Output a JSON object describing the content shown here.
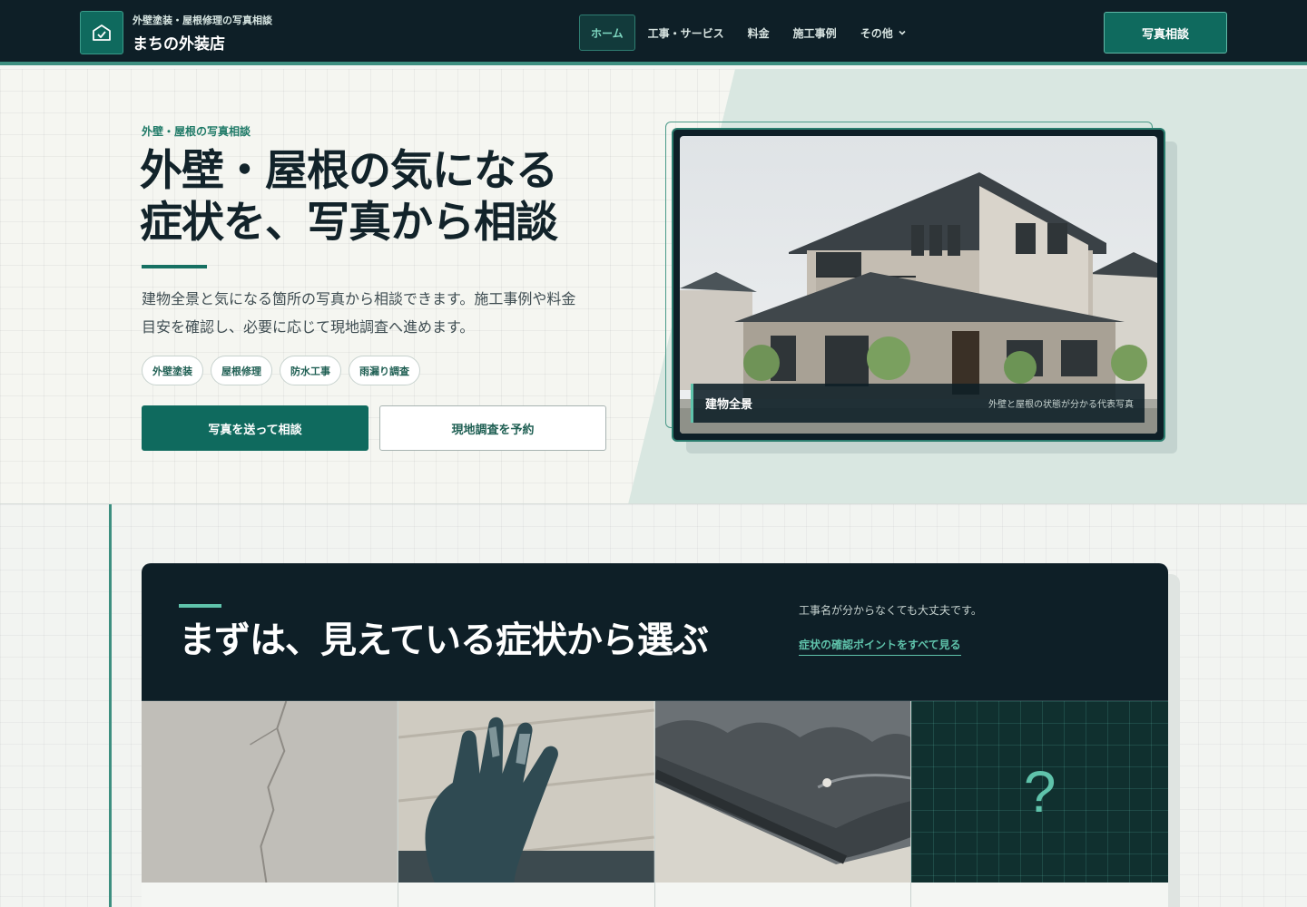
{
  "header": {
    "brand_sub": "外壁塗装・屋根修理の写真相談",
    "brand_name": "まちの外装店",
    "logo_icon": "house-check-icon",
    "nav": [
      {
        "label": "ホーム",
        "active": true
      },
      {
        "label": "工事・サービス",
        "active": false
      },
      {
        "label": "料金",
        "active": false
      },
      {
        "label": "施工事例",
        "active": false
      }
    ],
    "nav_more": "その他",
    "cta": "写真相談"
  },
  "hero": {
    "eyebrow": "外壁・屋根の写真相談",
    "title_line1": "外壁・屋根の気になる",
    "title_line2": "症状を、写真から相談",
    "desc_line1": "建物全景と気になる箇所の写真から相談できます。施工事例や料金",
    "desc_line2": "目安を確認し、必要に応じて現地調査へ進めます。",
    "tags": [
      "外壁塗装",
      "屋根修理",
      "防水工事",
      "雨漏り調査"
    ],
    "primary_button": "写真を送って相談",
    "secondary_button": "現地調査を予約",
    "photo_caption_title": "建物全景",
    "photo_caption_note": "外壁と屋根の状態が分かる代表写真"
  },
  "symptoms": {
    "title": "まずは、見えている症状から選ぶ",
    "note": "工事名が分からなくても大丈夫です。",
    "link": "症状の確認ポイントをすべて見る",
    "unknown_mark": "?"
  },
  "colors": {
    "header_bg": "#0e1f27",
    "accent": "#0f6a5e",
    "accent_light": "#5fc3ab",
    "hero_tint": "#d9e7e1"
  }
}
